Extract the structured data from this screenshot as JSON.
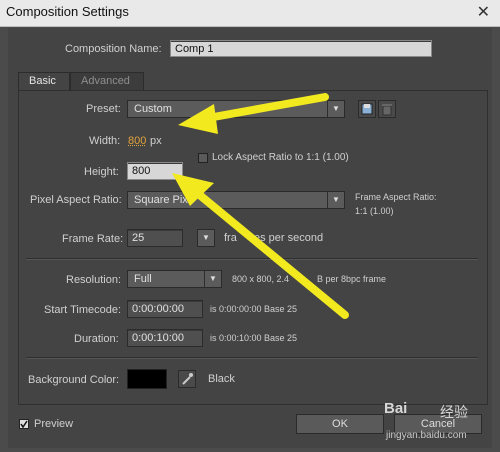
{
  "window": {
    "title": "Composition Settings",
    "close_glyph": "✕"
  },
  "composition_name": {
    "label": "Composition Name:",
    "value": "Comp 1"
  },
  "tabs": [
    {
      "label": "Basic"
    },
    {
      "label": "Advanced"
    }
  ],
  "preset": {
    "label": "Preset:",
    "value": "Custom",
    "icons": [
      "save-preset-icon",
      "delete-preset-icon"
    ]
  },
  "width": {
    "label": "Width:",
    "value": "800",
    "unit": "px"
  },
  "height": {
    "label": "Height:",
    "value": "800"
  },
  "lock_aspect": {
    "label": "Lock Aspect Ratio to 1:1 (1.00)",
    "checked": false
  },
  "pixel_aspect": {
    "label": "Pixel Aspect Ratio:",
    "value": "Square Pix"
  },
  "frame_aspect": {
    "label": "Frame Aspect Ratio:",
    "value": "1:1 (1.00)"
  },
  "frame_rate": {
    "label": "Frame Rate:",
    "value": "25",
    "suffix": "fra",
    "suffix2": "es per second"
  },
  "resolution": {
    "label": "Resolution:",
    "value": "Full",
    "info": "800 x 800, 2.4",
    "info2": "B per 8bpc frame"
  },
  "start_timecode": {
    "label": "Start Timecode:",
    "value": "0:00:00:00",
    "info": "is 0:00:00:00  Base 25"
  },
  "duration": {
    "label": "Duration:",
    "value": "0:00:10:00",
    "info": "is 0:00:10:00  Base 25"
  },
  "background_color": {
    "label": "Background Color:",
    "color_name": "Black",
    "swatch": "#000000"
  },
  "preview": {
    "label": "Preview",
    "checked": true
  },
  "buttons": {
    "ok": "OK",
    "cancel": "Cancel"
  },
  "watermark": {
    "brand": "Bai",
    "brand2": "经验",
    "url": "jingyan.baidu.com"
  },
  "colors": {
    "accent_orange": "#e2a23b",
    "arrow_yellow": "#f2ea1f",
    "dialog_bg": "#444444"
  }
}
